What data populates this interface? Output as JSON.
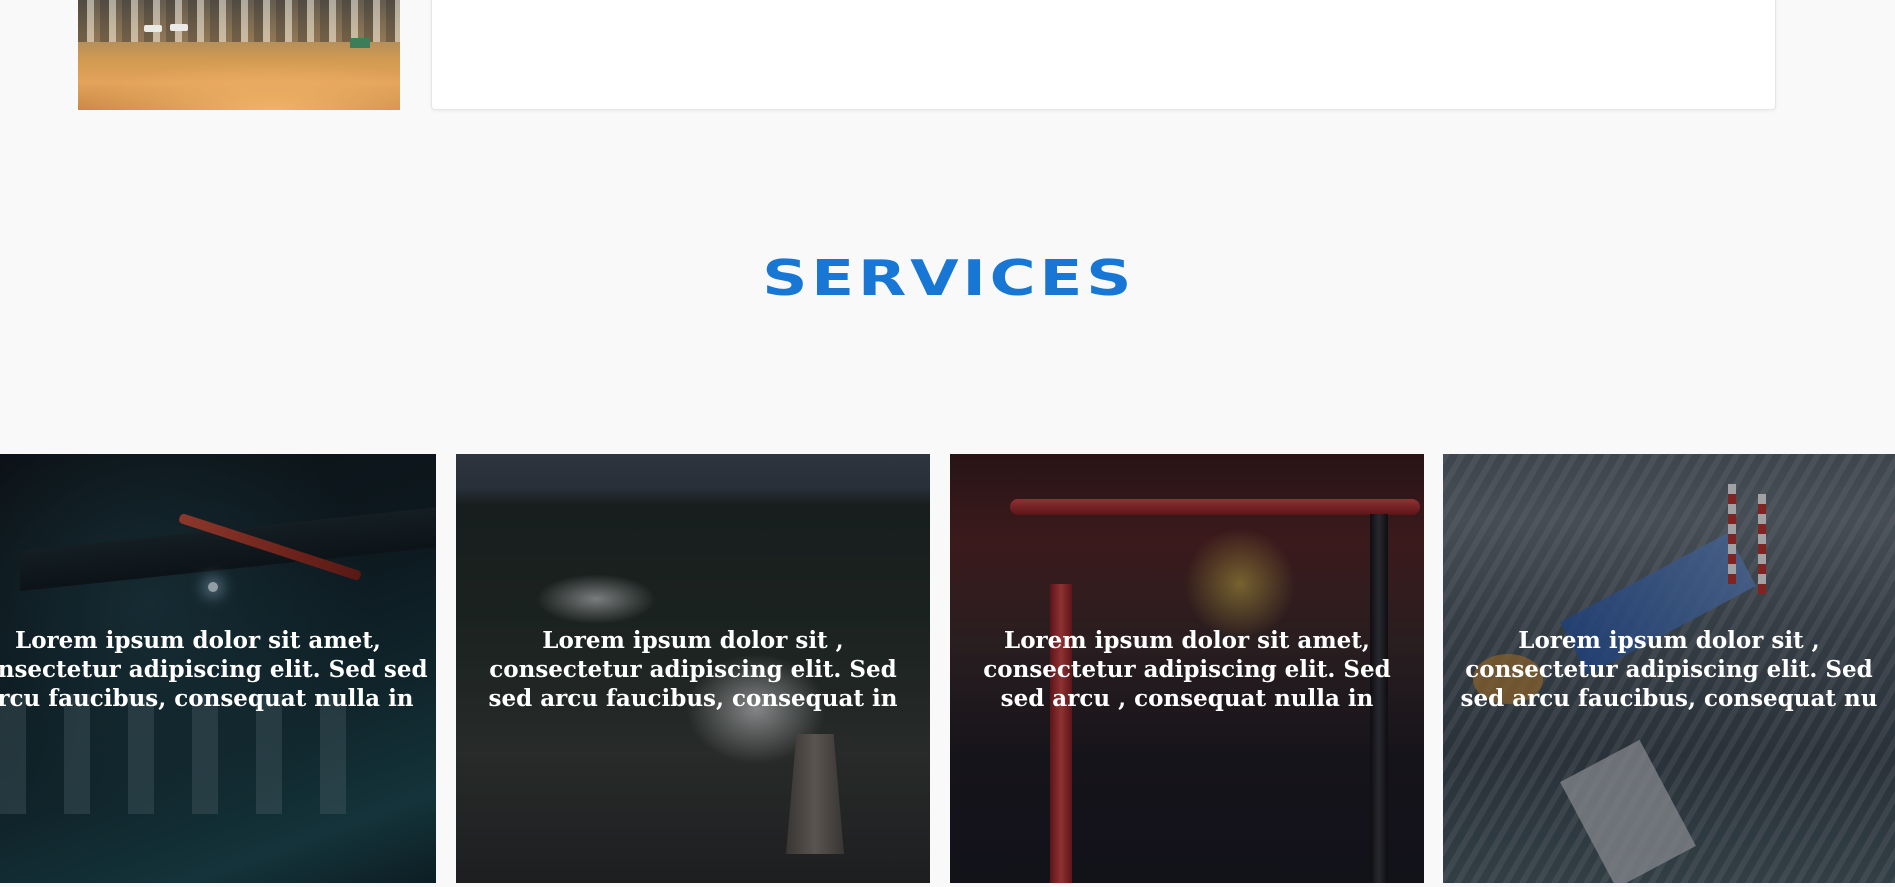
{
  "top_section": {
    "image_alt": "Desert oil field site"
  },
  "services": {
    "title": "SERVICES",
    "accent_color": "#1877d4",
    "cards": [
      {
        "text": "Lorem ipsum dolor sit amet, consectetur adipiscing elit. Sed sed arcu faucibus, consequat nulla in",
        "image": "gas-station-night"
      },
      {
        "text": "Lorem ipsum dolor sit  , consectetur adipiscing elit. Sed sed arcu faucibus, consequat   in",
        "image": "power-plant-aerial"
      },
      {
        "text": "Lorem ipsum dolor sit amet, consectetur adipiscing elit. Sed sed arcu  , consequat nulla in",
        "image": "industrial-pipes"
      },
      {
        "text": "Lorem ipsum dolor sit  , consectetur adipiscing elit. Sed sed arcu faucibus, consequat nu",
        "image": "refinery-aerial"
      }
    ]
  }
}
